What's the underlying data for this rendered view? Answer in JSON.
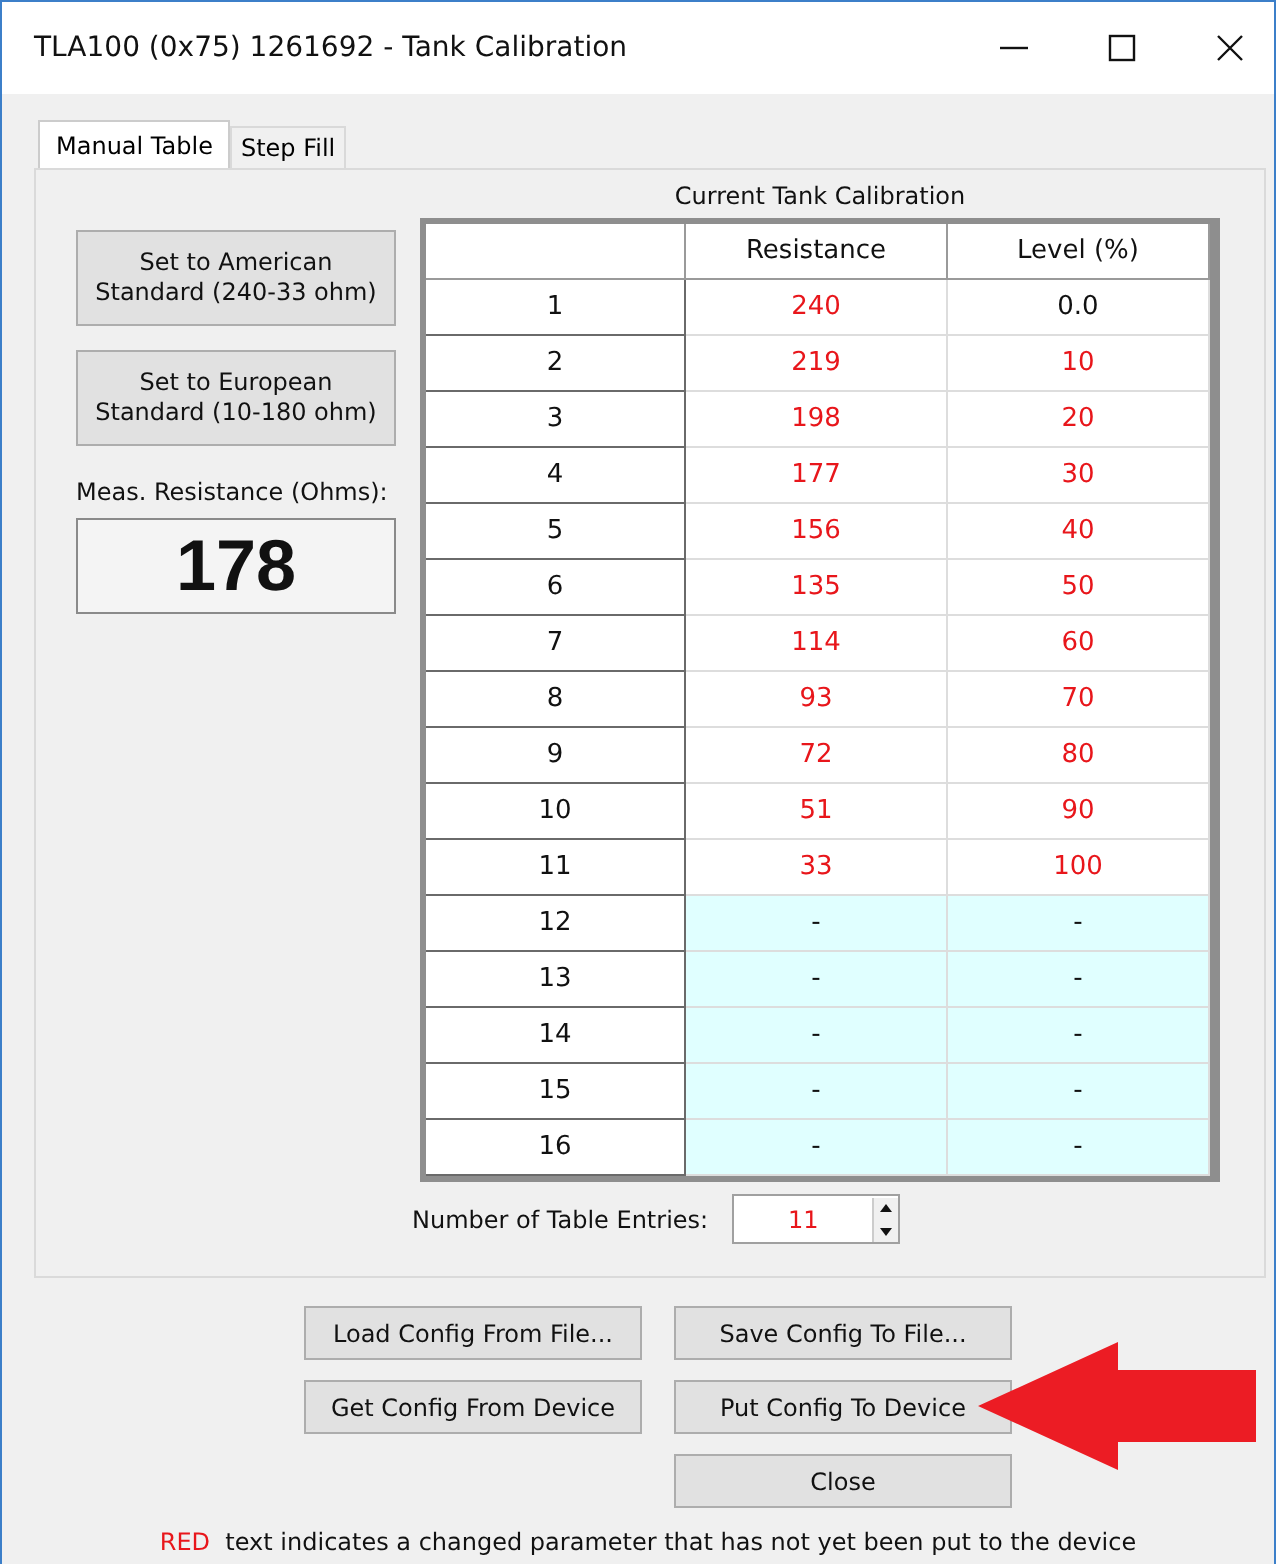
{
  "window": {
    "title": "TLA100 (0x75) 1261692 - Tank Calibration"
  },
  "tabs": [
    {
      "label": "Manual Table",
      "selected": true
    },
    {
      "label": "Step Fill",
      "selected": false
    }
  ],
  "standard_buttons": [
    "Set to American Standard (240-33 ohm)",
    "Set to European Standard (10-180 ohm)"
  ],
  "measured": {
    "label": "Meas. Resistance (Ohms):",
    "value": "178"
  },
  "table": {
    "title": "Current Tank Calibration",
    "columns": [
      "Resistance",
      "Level (%)"
    ],
    "rows": [
      {
        "index": "1",
        "in_use": true,
        "cells": [
          {
            "value": "240",
            "changed": true
          },
          {
            "value": "0.0",
            "changed": false
          }
        ]
      },
      {
        "index": "2",
        "in_use": true,
        "cells": [
          {
            "value": "219",
            "changed": true
          },
          {
            "value": "10",
            "changed": true
          }
        ]
      },
      {
        "index": "3",
        "in_use": true,
        "cells": [
          {
            "value": "198",
            "changed": true
          },
          {
            "value": "20",
            "changed": true
          }
        ]
      },
      {
        "index": "4",
        "in_use": true,
        "cells": [
          {
            "value": "177",
            "changed": true
          },
          {
            "value": "30",
            "changed": true
          }
        ]
      },
      {
        "index": "5",
        "in_use": true,
        "cells": [
          {
            "value": "156",
            "changed": true
          },
          {
            "value": "40",
            "changed": true
          }
        ]
      },
      {
        "index": "6",
        "in_use": true,
        "cells": [
          {
            "value": "135",
            "changed": true
          },
          {
            "value": "50",
            "changed": true
          }
        ]
      },
      {
        "index": "7",
        "in_use": true,
        "cells": [
          {
            "value": "114",
            "changed": true
          },
          {
            "value": "60",
            "changed": true
          }
        ]
      },
      {
        "index": "8",
        "in_use": true,
        "cells": [
          {
            "value": "93",
            "changed": true
          },
          {
            "value": "70",
            "changed": true
          }
        ]
      },
      {
        "index": "9",
        "in_use": true,
        "cells": [
          {
            "value": "72",
            "changed": true
          },
          {
            "value": "80",
            "changed": true
          }
        ]
      },
      {
        "index": "10",
        "in_use": true,
        "cells": [
          {
            "value": "51",
            "changed": true
          },
          {
            "value": "90",
            "changed": true
          }
        ]
      },
      {
        "index": "11",
        "in_use": true,
        "cells": [
          {
            "value": "33",
            "changed": true
          },
          {
            "value": "100",
            "changed": true
          }
        ]
      },
      {
        "index": "12",
        "in_use": false,
        "cells": [
          {
            "value": "-",
            "changed": false
          },
          {
            "value": "-",
            "changed": false
          }
        ]
      },
      {
        "index": "13",
        "in_use": false,
        "cells": [
          {
            "value": "-",
            "changed": false
          },
          {
            "value": "-",
            "changed": false
          }
        ]
      },
      {
        "index": "14",
        "in_use": false,
        "cells": [
          {
            "value": "-",
            "changed": false
          },
          {
            "value": "-",
            "changed": false
          }
        ]
      },
      {
        "index": "15",
        "in_use": false,
        "cells": [
          {
            "value": "-",
            "changed": false
          },
          {
            "value": "-",
            "changed": false
          }
        ]
      },
      {
        "index": "16",
        "in_use": false,
        "cells": [
          {
            "value": "-",
            "changed": false
          },
          {
            "value": "-",
            "changed": false
          }
        ]
      }
    ]
  },
  "entries": {
    "label": "Number of Table Entries:",
    "value": "11",
    "changed": true
  },
  "buttons": [
    [
      "Load Config From File...",
      "Save Config To File..."
    ],
    [
      "Get Config From Device",
      "Put Config To Device"
    ],
    [
      "Close"
    ]
  ],
  "footer": {
    "marker": "RED",
    "text": "text indicates a changed parameter that has not yet been put to the device"
  }
}
